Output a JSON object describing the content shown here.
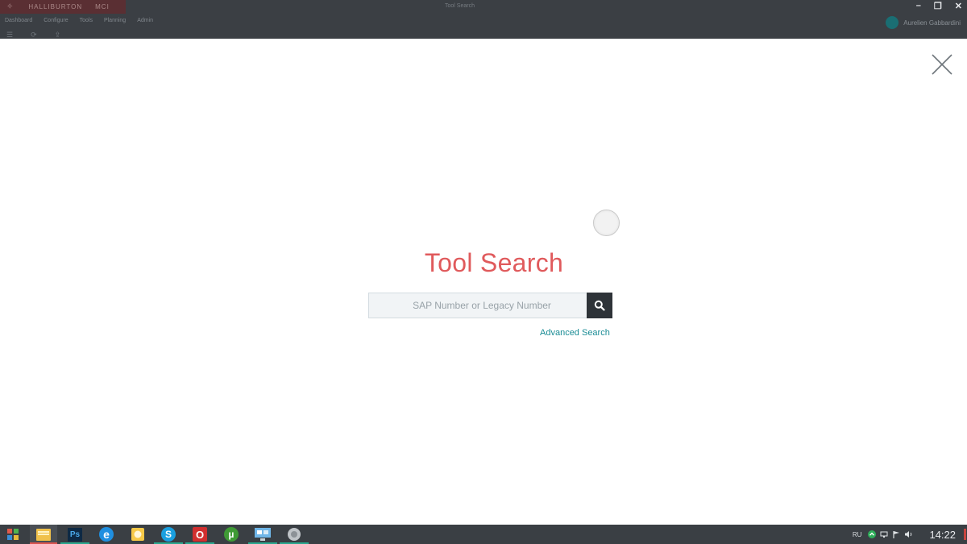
{
  "app": {
    "brand": "HALLIBURTON",
    "brand_suffix": "MCI",
    "window_title": "Tool Search",
    "menu": [
      "Dashboard",
      "Configure",
      "Tools",
      "Planning",
      "Admin"
    ],
    "user_name": "Aurelien Gabbardini"
  },
  "overlay": {
    "title": "Tool Search",
    "search_placeholder": "SAP Number or Legacy Number",
    "search_value": "",
    "advanced_link": "Advanced Search",
    "accent_color": "#e05a5c",
    "link_color": "#1a8c95"
  },
  "taskbar": {
    "apps": [
      {
        "name": "file-explorer",
        "label": ""
      },
      {
        "name": "photoshop",
        "label": "Ps"
      },
      {
        "name": "internet-explorer",
        "label": "e"
      },
      {
        "name": "sticky-notes",
        "label": ""
      },
      {
        "name": "skype",
        "label": "S"
      },
      {
        "name": "opera",
        "label": "O"
      },
      {
        "name": "utorrent",
        "label": "µ"
      },
      {
        "name": "remote-desktop",
        "label": ""
      },
      {
        "name": "settings",
        "label": ""
      }
    ],
    "language": "RU",
    "clock": "14:22"
  }
}
